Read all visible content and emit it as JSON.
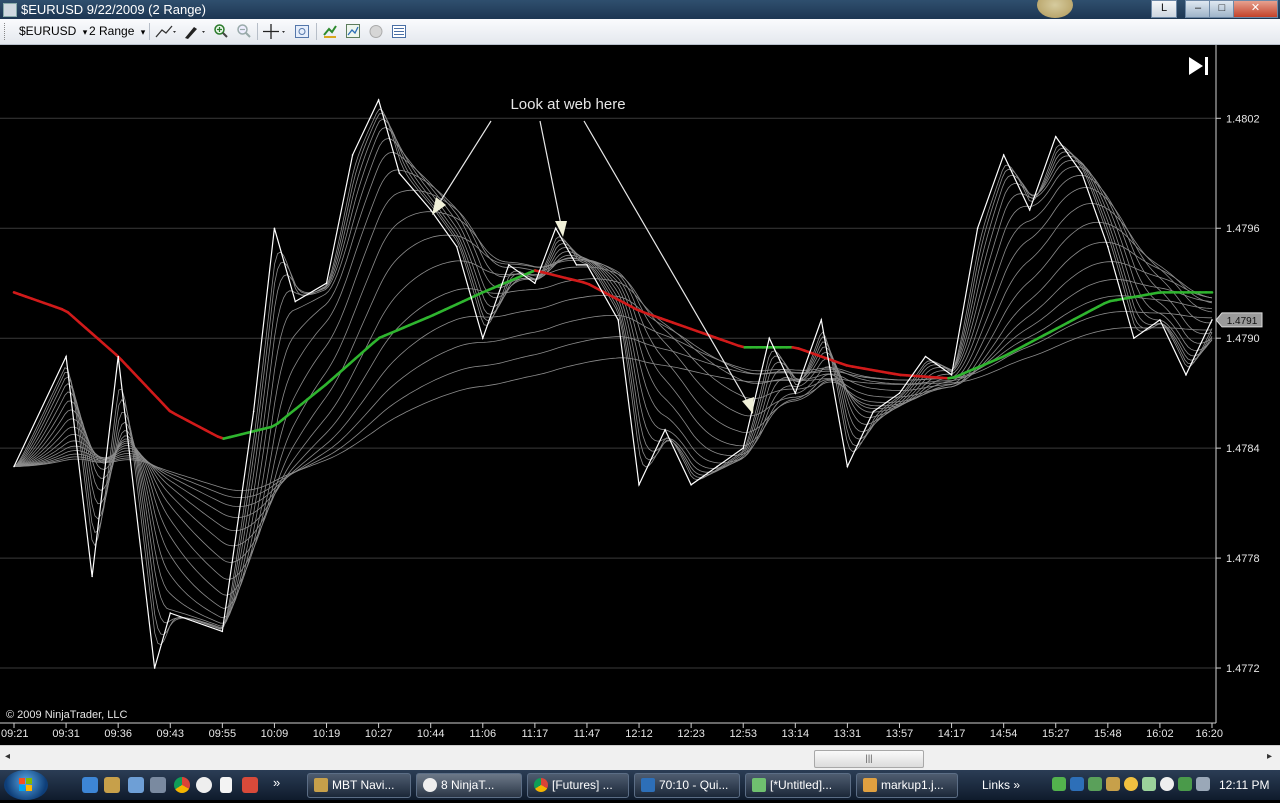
{
  "window": {
    "title": "$EURUSD  9/22/2009 (2 Range)",
    "button_l": "L",
    "minimize": "–",
    "maximize": "□",
    "close": "✕"
  },
  "toolbar": {
    "instrument": "$EURUSD",
    "interval": "2 Range",
    "dropdown_glyph": "▾"
  },
  "chart": {
    "annotation": "Look at web here",
    "copyright": "© 2009 NinjaTrader, LLC",
    "play_end_glyph": "▶|",
    "current_price": "1.4791",
    "accent_colors": {
      "rising": "#2fb52f",
      "falling": "#d11a1a",
      "price": "#ffffff",
      "ribbon": "#8c8c8c"
    }
  },
  "chart_data": {
    "type": "line",
    "x_ticks": [
      "09:21",
      "09:31",
      "09:36",
      "09:43",
      "09:55",
      "10:09",
      "10:19",
      "10:27",
      "10:44",
      "11:06",
      "11:17",
      "11:47",
      "12:12",
      "12:23",
      "12:53",
      "13:14",
      "13:31",
      "13:57",
      "14:17",
      "14:54",
      "15:27",
      "15:48",
      "16:02",
      "16:20"
    ],
    "y_ticks": [
      "1.4802",
      "1.4796",
      "1.4790",
      "1.4784",
      "1.4778",
      "1.4772"
    ],
    "ylim": [
      1.4769,
      1.4806
    ],
    "grid": true,
    "series": [
      {
        "role": "price",
        "x": [
          0,
          1,
          1.5,
          2,
          2.7,
          3,
          4,
          4.6,
          5,
          5.4,
          6,
          6.5,
          7,
          7.4,
          8,
          8.5,
          9,
          9.5,
          10,
          10.4,
          10.8,
          11,
          11.6,
          12,
          12.5,
          13,
          13.5,
          14,
          14.5,
          15,
          15.5,
          16,
          16.5,
          17,
          17.5,
          18,
          18.5,
          19,
          19.5,
          20,
          20.5,
          21,
          21.5,
          22,
          22.5,
          23
        ],
        "y": [
          1.4783,
          1.4789,
          1.4777,
          1.4789,
          1.4772,
          1.4775,
          1.4774,
          1.4786,
          1.4796,
          1.4792,
          1.4793,
          1.48,
          1.4803,
          1.4799,
          1.4797,
          1.4795,
          1.479,
          1.4794,
          1.4793,
          1.4796,
          1.4794,
          1.4794,
          1.4791,
          1.4782,
          1.4785,
          1.4782,
          1.4783,
          1.4784,
          1.479,
          1.4787,
          1.4791,
          1.4783,
          1.4786,
          1.4787,
          1.4789,
          1.4788,
          1.4796,
          1.48,
          1.4797,
          1.4801,
          1.4799,
          1.4795,
          1.479,
          1.4791,
          1.4788,
          1.4791
        ]
      },
      {
        "role": "moving-average",
        "x": [
          0,
          1,
          2,
          3,
          4,
          5,
          6,
          7,
          8,
          9,
          10,
          11,
          12,
          13,
          14,
          15,
          16,
          17,
          18,
          19,
          20,
          21,
          22,
          23
        ],
        "y": [
          1.47925,
          1.47915,
          1.4789,
          1.4786,
          1.47845,
          1.47852,
          1.47875,
          1.479,
          1.47912,
          1.47925,
          1.47937,
          1.4793,
          1.47915,
          1.47905,
          1.47895,
          1.47895,
          1.47885,
          1.4788,
          1.47878,
          1.4789,
          1.47905,
          1.4792,
          1.47925,
          1.47925
        ]
      }
    ]
  },
  "hscroll": {
    "thumb": "|||",
    "left_arrow": "◂",
    "right_arrow": "▸"
  },
  "taskbar": {
    "chevron": "»",
    "tasks": [
      "MBT Navi...",
      "8 NinjaT...",
      "[Futures] ...",
      "70:10 - Qui...",
      "[*Untitled]...",
      "markup1.j..."
    ],
    "links_label": "Links",
    "clock": "12:11 PM"
  }
}
